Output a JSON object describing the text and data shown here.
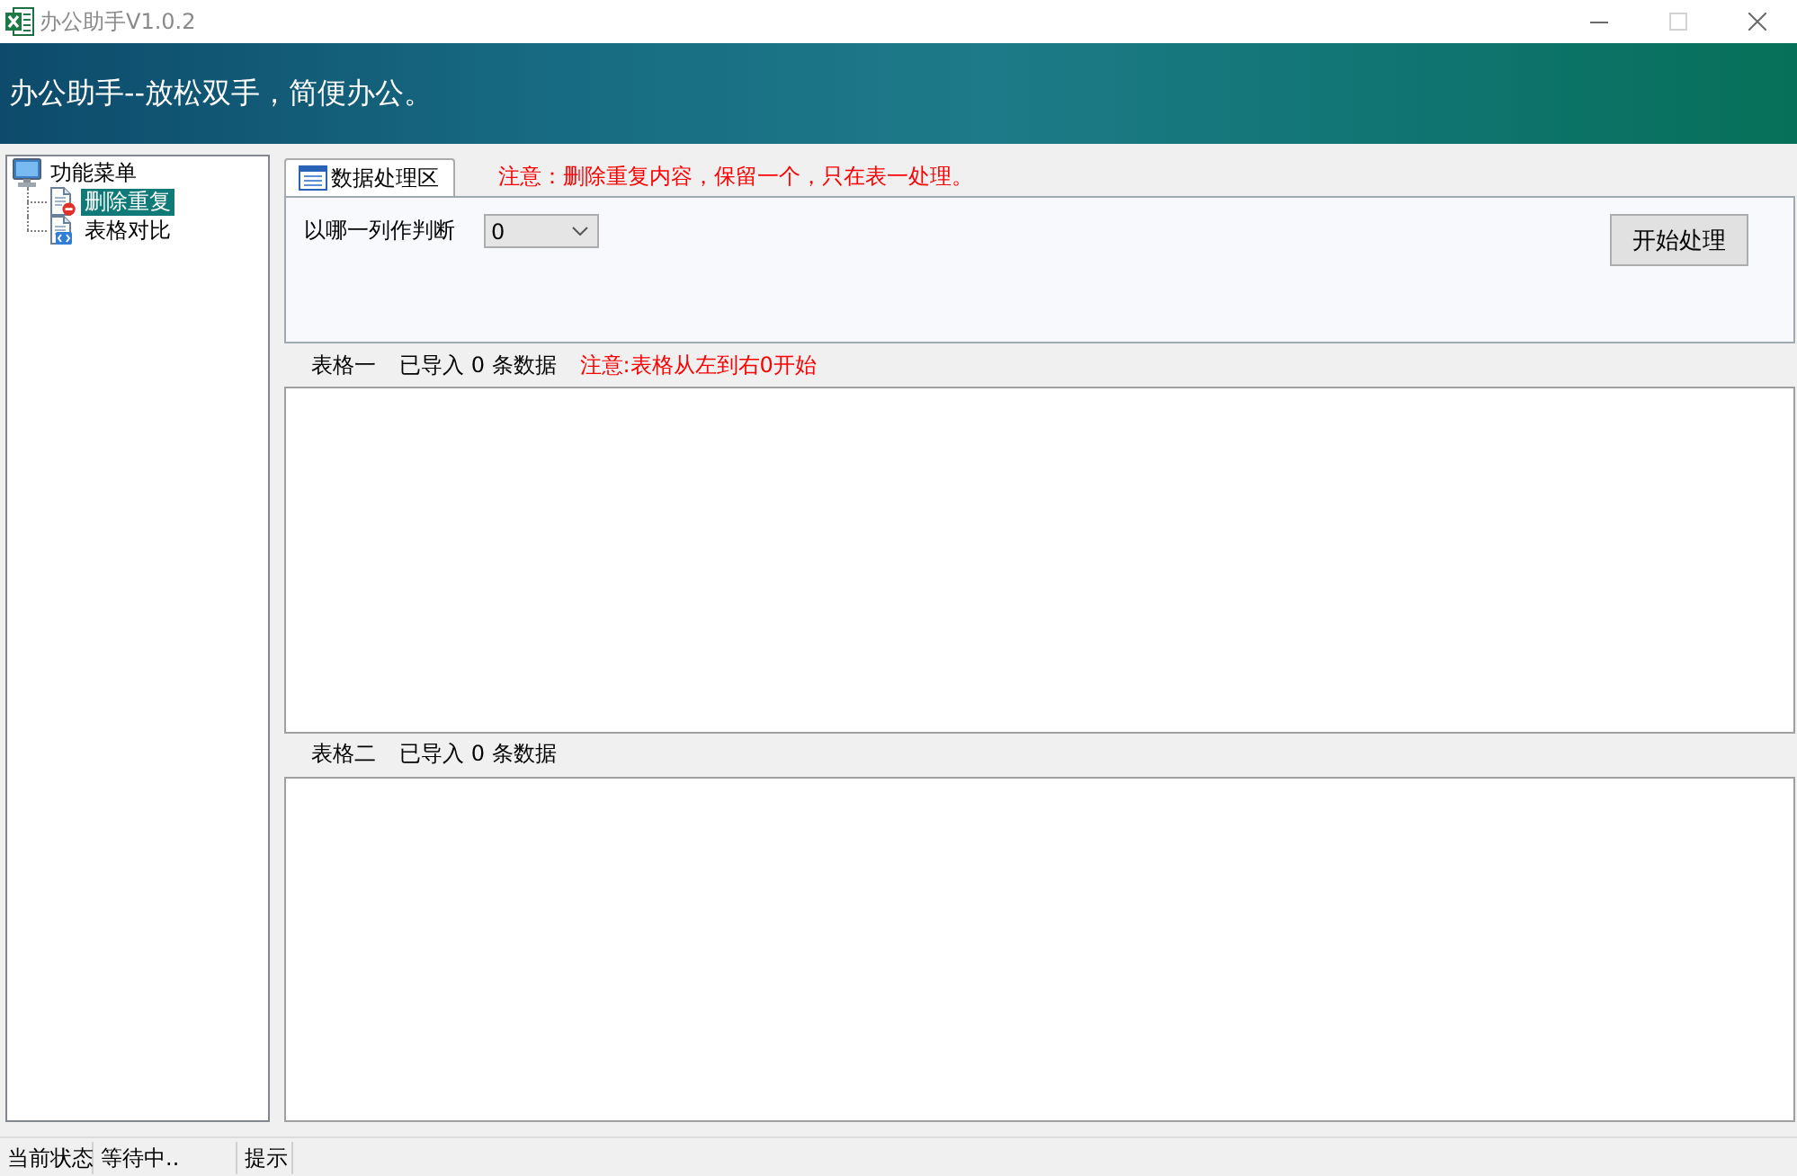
{
  "window": {
    "title": "办公助手V1.0.2",
    "controls": [
      {
        "kind": "minimize",
        "disabled": false
      },
      {
        "kind": "maximize",
        "disabled": true
      },
      {
        "kind": "close",
        "disabled": false
      }
    ]
  },
  "header": {
    "title": "办公助手--放松双手，简便办公。"
  },
  "sidebar": {
    "tree": [
      {
        "label": "功能菜单",
        "kind": "computer",
        "selected": false,
        "children": [
          {
            "label": "删除重复",
            "kind": "document-remove",
            "selected": true
          },
          {
            "label": "表格对比",
            "kind": "document-code",
            "selected": false
          }
        ]
      }
    ]
  },
  "tabs": [
    {
      "label": "数据处理区",
      "selected": true
    }
  ],
  "notice": "注意：删除重复内容，保留一个，只在表一处理。",
  "settings": {
    "label": "以哪一列作判断",
    "column_select": {
      "value": "0"
    },
    "start_button": "开始处理"
  },
  "tables": [
    {
      "title": "表格一",
      "status": "已导入 0 条数据",
      "note": "注意:表格从左到右0开始"
    },
    {
      "title": "表格二",
      "status": "已导入 0 条数据"
    }
  ],
  "status_bar": [
    "当前状态",
    "等待中..",
    "提示"
  ]
}
